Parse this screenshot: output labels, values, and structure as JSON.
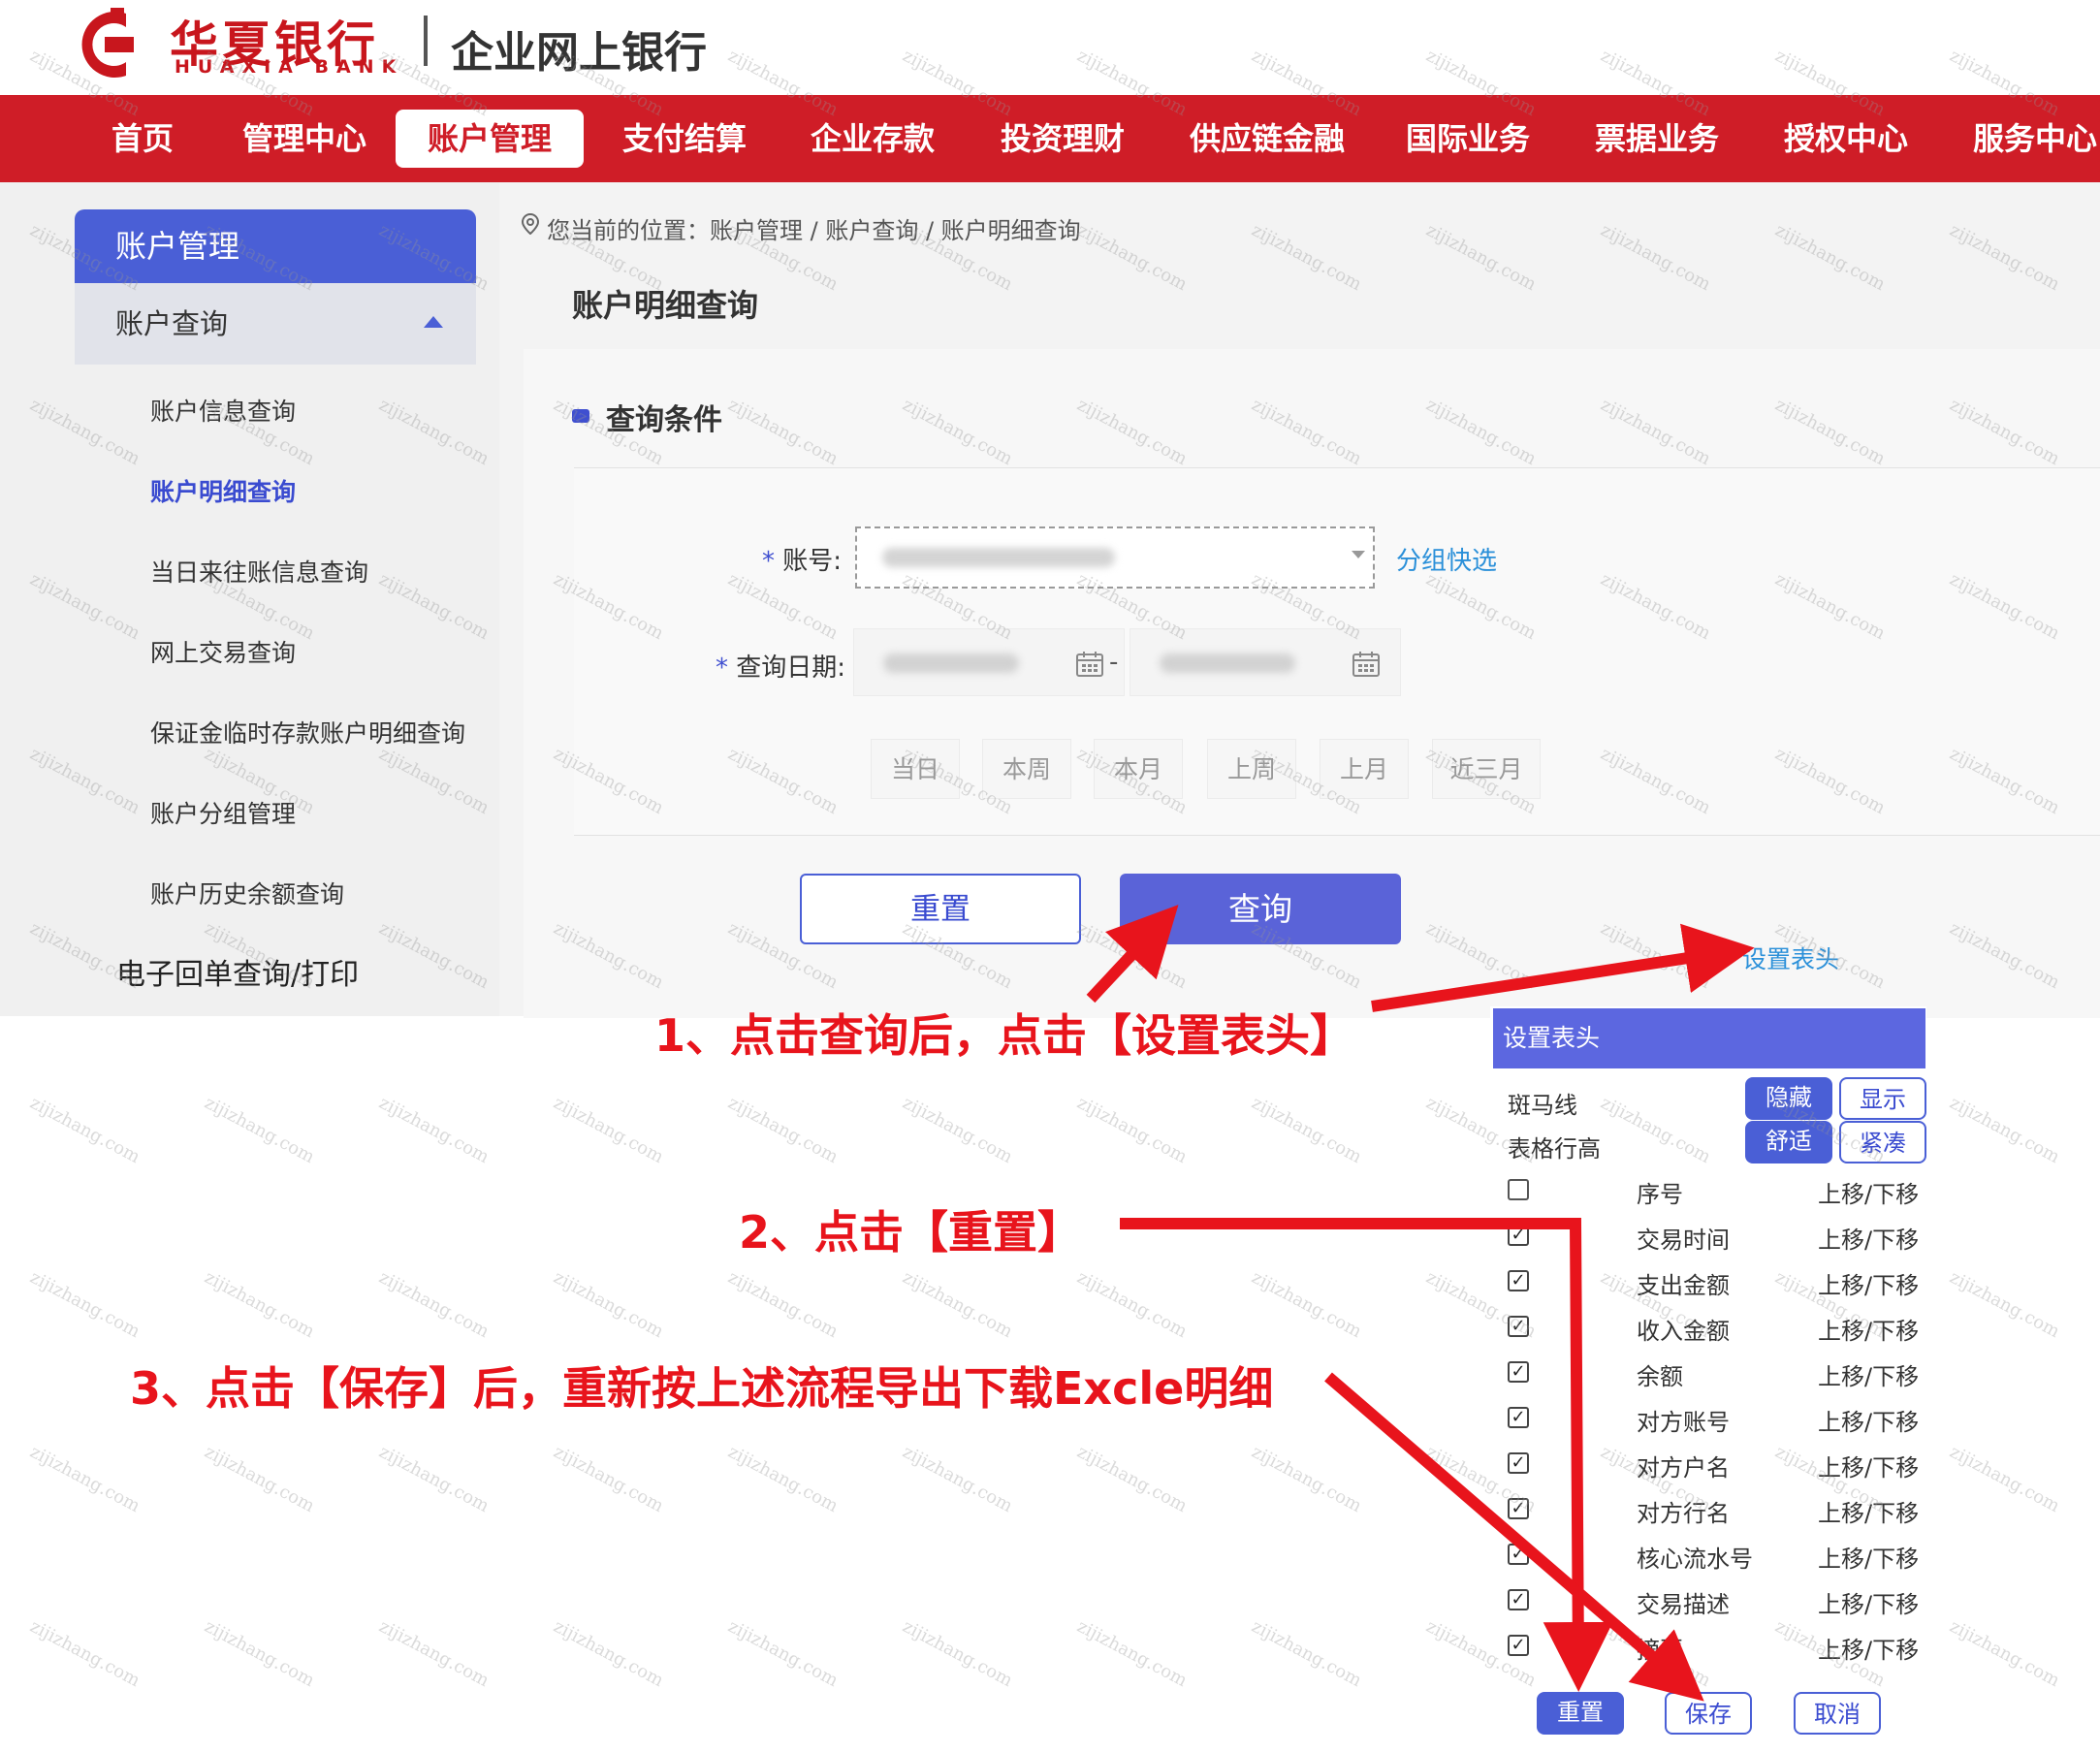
{
  "header": {
    "logo_cn": "华夏银行",
    "logo_en": "HUAXIA BANK",
    "subtitle": "企业网上银行"
  },
  "nav": {
    "items": [
      "首页",
      "管理中心",
      "账户管理",
      "支付结算",
      "企业存款",
      "投资理财",
      "供应链金融",
      "国际业务",
      "票据业务",
      "授权中心",
      "服务中心"
    ],
    "active": "账户管理"
  },
  "sidebar": {
    "title": "账户管理",
    "group": "账户查询",
    "items": [
      "账户信息查询",
      "账户明细查询",
      "当日来往账信息查询",
      "网上交易查询",
      "保证金临时存款账户明细查询",
      "账户分组管理",
      "账户历史余额查询"
    ],
    "active": "账户明细查询",
    "extra": "电子回单查询/打印"
  },
  "breadcrumb": "您当前的位置：账户管理 / 账户查询 / 账户明细查询",
  "page_title": "账户明细查询",
  "query": {
    "section_title": "查询条件",
    "account_label": "账号:",
    "group_quick": "分组快选",
    "date_label": "查询日期:",
    "date_sep": "-",
    "quick_ranges": [
      "当日",
      "本周",
      "本月",
      "上周",
      "上月",
      "近三月"
    ],
    "reset_label": "重置",
    "query_label": "查询",
    "set_header_link": "设置表头"
  },
  "dialog": {
    "title": "设置表头",
    "zebra_label": "斑马线",
    "zebra_options": [
      "隐藏",
      "显示"
    ],
    "row_height_label": "表格行高",
    "row_height_options": [
      "舒适",
      "紧凑"
    ],
    "move_label": "上移/下移",
    "columns": [
      {
        "name": "序号",
        "checked": false
      },
      {
        "name": "交易时间",
        "checked": true
      },
      {
        "name": "支出金额",
        "checked": true
      },
      {
        "name": "收入金额",
        "checked": true
      },
      {
        "name": "余额",
        "checked": true
      },
      {
        "name": "对方账号",
        "checked": true
      },
      {
        "name": "对方户名",
        "checked": true
      },
      {
        "name": "对方行名",
        "checked": true
      },
      {
        "name": "核心流水号",
        "checked": true
      },
      {
        "name": "交易描述",
        "checked": true
      },
      {
        "name": "摘要",
        "checked": true
      }
    ],
    "buttons": {
      "reset": "重置",
      "save": "保存",
      "cancel": "取消"
    }
  },
  "annotations": {
    "step1": "1、点击查询后，点击【设置表头】",
    "step2": "2、点击【重置】",
    "step3": "3、点击【保存】后，重新按上述流程导出下载Excle明细"
  },
  "watermark": "zijizhang.com",
  "colors": {
    "brand_red": "#cf1d27",
    "primary_blue": "#4a5fd6",
    "link_blue": "#2b90d9",
    "annotation_red": "#e8141c"
  }
}
